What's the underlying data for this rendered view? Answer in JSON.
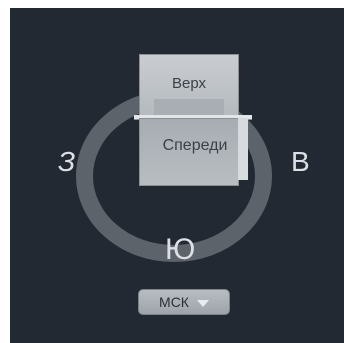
{
  "compass": {
    "west": "З",
    "east": "В",
    "south": "Ю"
  },
  "viewcube": {
    "top_face": "Верх",
    "front_face": "Спереди"
  },
  "ucs_menu": {
    "label": "МСК",
    "icon": "chevron-down-icon"
  }
}
